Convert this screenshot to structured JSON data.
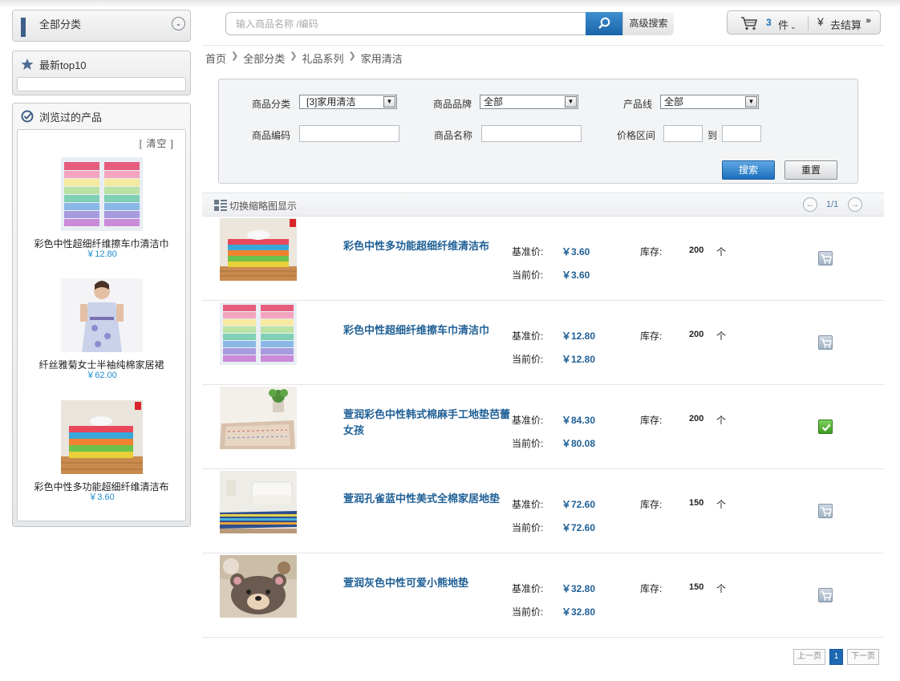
{
  "sidebar": {
    "all_categories": "全部分类",
    "latest_top10": "最新top10",
    "browsed": "浏览过的产品",
    "clear": "[ 清空 ]",
    "history": [
      {
        "name": "彩色中性超细纤维擦车巾清洁巾",
        "price": "￥12.80"
      },
      {
        "name": "纤丝雅菊女士半袖纯棉家居裙",
        "price": "￥62.00"
      },
      {
        "name": "彩色中性多功能超细纤维清洁布",
        "price": "￥3.60"
      }
    ]
  },
  "search": {
    "placeholder": "输入商品名称 /编码",
    "advanced": "高级搜索"
  },
  "cart": {
    "count": "3",
    "unit": "件",
    "checkout": "去结算"
  },
  "breadcrumb": [
    "首页",
    "全部分类",
    "礼品系列",
    "家用清洁"
  ],
  "filter": {
    "category_label": "商品分类",
    "category_value": "[3]家用清洁",
    "brand_label": "商品品牌",
    "brand_value": "全部",
    "line_label": "产品线",
    "line_value": "全部",
    "code_label": "商品编码",
    "name_label": "商品名称",
    "price_label": "价格区间",
    "to": "到",
    "search_btn": "搜索",
    "reset_btn": "重置"
  },
  "listbar": {
    "toggle": "切换缩略图显示",
    "page_info": "1/1"
  },
  "labels": {
    "base_price": "基准价:",
    "current_price": "当前价:",
    "stock": "库存:",
    "stock_unit": "个"
  },
  "products": [
    {
      "title": "彩色中性多功能超细纤维清洁布",
      "base_price": "￥3.60",
      "current_price": "￥3.60",
      "stock": "200",
      "cart_state": "add"
    },
    {
      "title": "彩色中性超细纤维擦车巾清洁巾",
      "base_price": "￥12.80",
      "current_price": "￥12.80",
      "stock": "200",
      "cart_state": "add"
    },
    {
      "title": "萱润彩色中性韩式棉麻手工地垫芭蕾女孩",
      "base_price": "￥84.30",
      "current_price": "￥80.08",
      "stock": "200",
      "cart_state": "added"
    },
    {
      "title": "萱润孔雀蓝中性美式全棉家居地垫",
      "base_price": "￥72.60",
      "current_price": "￥72.60",
      "stock": "150",
      "cart_state": "add"
    },
    {
      "title": "萱润灰色中性可爱小熊地垫",
      "base_price": "￥32.80",
      "current_price": "￥32.80",
      "stock": "150",
      "cart_state": "add"
    }
  ],
  "pager": {
    "prev": "上一页",
    "current": "1",
    "next": "下一页"
  },
  "colors": {
    "accent": "#1d68b3",
    "link": "#1e5f95",
    "price_blue": "#1d8ccf"
  }
}
